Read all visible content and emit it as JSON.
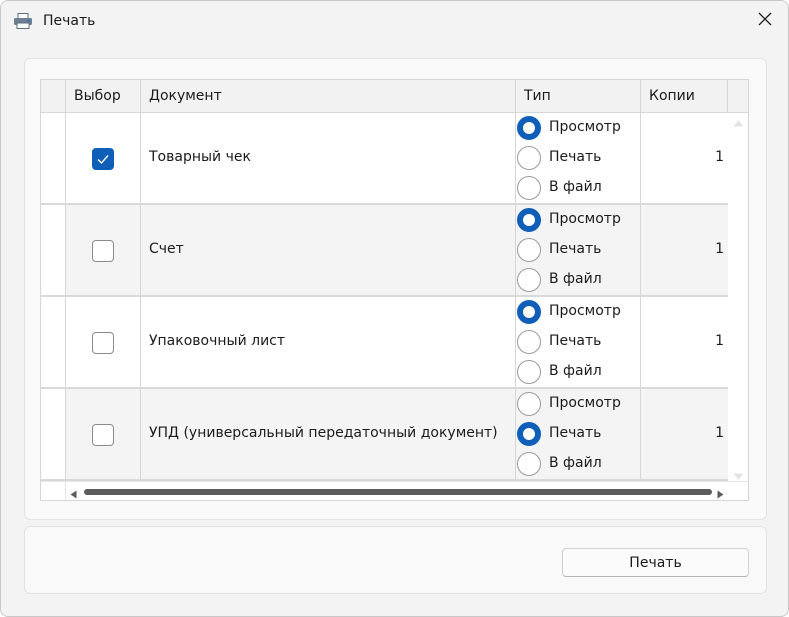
{
  "window": {
    "title": "Печать",
    "app_icon": "printer-icon",
    "close_icon": "close-icon"
  },
  "grid": {
    "columns": [
      "Выбор",
      "Документ",
      "Тип",
      "Копии"
    ],
    "type_options": [
      "Просмотр",
      "Печать",
      "В файл"
    ],
    "rows": [
      {
        "selected": true,
        "document": "Товарный чек",
        "type": "Просмотр",
        "copies": "1"
      },
      {
        "selected": false,
        "document": "Счет",
        "type": "Просмотр",
        "copies": "1"
      },
      {
        "selected": false,
        "document": "Упаковочный лист",
        "type": "Просмотр",
        "copies": "1"
      },
      {
        "selected": false,
        "document": "УПД (универсальный передаточный документ)",
        "type": "Печать",
        "copies": "1"
      }
    ]
  },
  "footer": {
    "print_button": "Печать"
  },
  "colors": {
    "accent": "#0f5eb8",
    "window_bg": "#f3f3f3",
    "grid_border": "#d6d6d6"
  }
}
